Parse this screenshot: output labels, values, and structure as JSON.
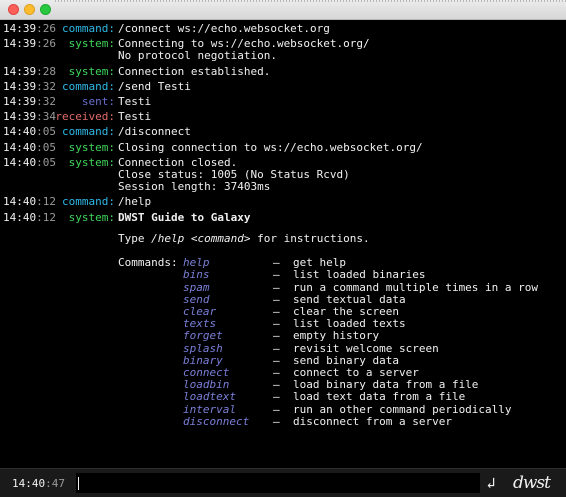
{
  "log": [
    {
      "time_hm": "14:39",
      "time_s": ":26",
      "label": "command:",
      "kind": "command",
      "lines": [
        "/connect ws://echo.websocket.org"
      ]
    },
    {
      "time_hm": "14:39",
      "time_s": ":26",
      "label": "system:",
      "kind": "system",
      "lines": [
        "Connecting to ws://echo.websocket.org/",
        "No protocol negotiation."
      ]
    },
    {
      "time_hm": "14:39",
      "time_s": ":28",
      "label": "system:",
      "kind": "system",
      "lines": [
        "Connection established."
      ]
    },
    {
      "time_hm": "14:39",
      "time_s": ":32",
      "label": "command:",
      "kind": "command",
      "lines": [
        "/send Testi"
      ]
    },
    {
      "time_hm": "14:39",
      "time_s": ":32",
      "label": "sent:",
      "kind": "sent",
      "lines": [
        "Testi"
      ]
    },
    {
      "time_hm": "14:39",
      "time_s": ":34",
      "label": "received:",
      "kind": "received",
      "lines": [
        "Testi"
      ]
    },
    {
      "time_hm": "14:40",
      "time_s": ":05",
      "label": "command:",
      "kind": "command",
      "lines": [
        "/disconnect"
      ]
    },
    {
      "time_hm": "14:40",
      "time_s": ":05",
      "label": "system:",
      "kind": "system",
      "lines": [
        "Closing connection to ws://echo.websocket.org/"
      ]
    },
    {
      "time_hm": "14:40",
      "time_s": ":05",
      "label": "system:",
      "kind": "system",
      "lines": [
        "Connection closed.",
        "Close status: 1005 (No Status Rcvd)",
        "Session length: 37403ms"
      ]
    },
    {
      "time_hm": "14:40",
      "time_s": ":12",
      "label": "command:",
      "kind": "command",
      "lines": [
        "/help"
      ]
    },
    {
      "time_hm": "14:40",
      "time_s": ":12",
      "label": "system:",
      "kind": "system",
      "lines": [
        "DWST Guide to Galaxy"
      ]
    }
  ],
  "help": {
    "type_prefix": "Type ",
    "type_cmd": "/help <command>",
    "type_suffix": " for instructions.",
    "commands_label": "Commands:",
    "dash": "—",
    "commands": [
      {
        "name": "help",
        "desc": "get help"
      },
      {
        "name": "bins",
        "desc": "list loaded binaries"
      },
      {
        "name": "spam",
        "desc": "run a command multiple times in a row"
      },
      {
        "name": "send",
        "desc": "send textual data"
      },
      {
        "name": "clear",
        "desc": "clear the screen"
      },
      {
        "name": "texts",
        "desc": "list loaded texts"
      },
      {
        "name": "forget",
        "desc": "empty history"
      },
      {
        "name": "splash",
        "desc": "revisit welcome screen"
      },
      {
        "name": "binary",
        "desc": "send binary data"
      },
      {
        "name": "connect",
        "desc": "connect to a server"
      },
      {
        "name": "loadbin",
        "desc": "load binary data from a file"
      },
      {
        "name": "loadtext",
        "desc": "load text data from a file"
      },
      {
        "name": "interval",
        "desc": "run an other command periodically"
      },
      {
        "name": "disconnect",
        "desc": "disconnect from a server"
      }
    ]
  },
  "prompt": {
    "time_hm": "14:40",
    "time_s": ":47",
    "input_value": "",
    "enter_icon": "return-arrow-icon",
    "logo_text": "dwst"
  },
  "colors": {
    "command": "#2fb8e6",
    "system": "#3fd65a",
    "sent": "#6a6fd0",
    "received": "#e06a6a",
    "command_name": "#7a7fd8"
  }
}
